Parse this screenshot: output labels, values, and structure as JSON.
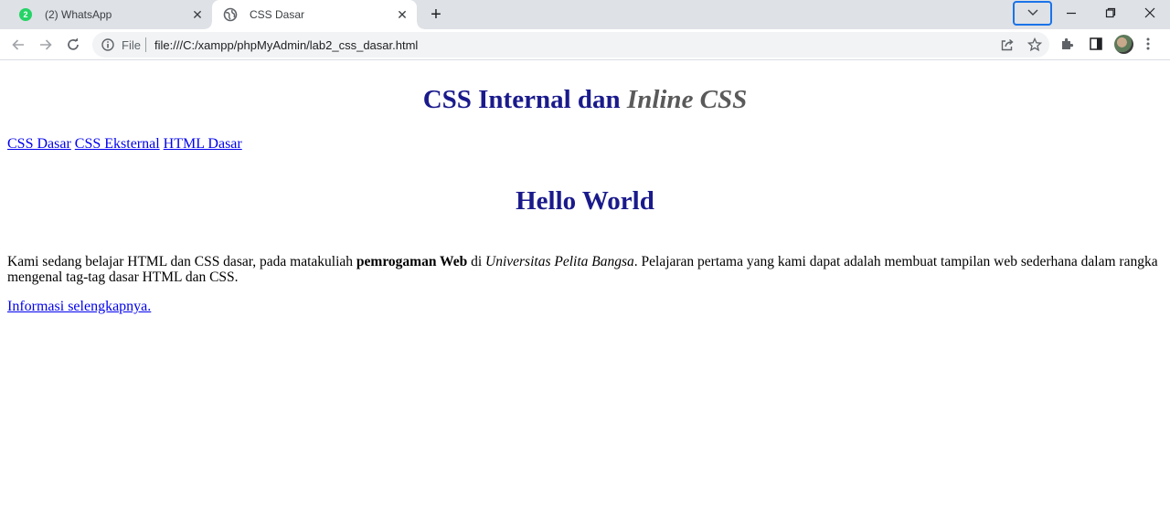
{
  "browser": {
    "tabs": [
      {
        "title": "(2) WhatsApp",
        "badge": "2",
        "icon": "whatsapp-icon",
        "active": false
      },
      {
        "title": "CSS Dasar",
        "icon": "globe-icon",
        "active": true
      }
    ],
    "address": {
      "scheme_label": "File",
      "url": "file:///C:/xampp/phpMyAdmin/lab2_css_dasar.html"
    },
    "colors": {
      "tabstrip": "#dee1e6",
      "focus": "#1a73e8",
      "omnibox": "#f1f3f4"
    }
  },
  "page": {
    "heading": {
      "normal": "CSS Internal dan",
      "italic": "Inline CSS"
    },
    "nav_links": [
      "CSS Dasar",
      "CSS Eksternal",
      "HTML Dasar"
    ],
    "hello": "Hello World",
    "paragraph": {
      "part1": "Kami sedang belajar HTML dan CSS dasar, pada matakuliah ",
      "bold": "pemrogaman Web",
      "part2": " di ",
      "italic": "Universitas Pelita Bangsa",
      "part3": ". Pelajaran pertama yang kami dapat adalah membuat tampilan web sederhana dalam rangka mengenal tag-tag dasar HTML dan CSS."
    },
    "more_link": "Informasi selengkapnya.",
    "colors": {
      "heading": "#1a1a8c",
      "heading_italic": "#5a5a5a",
      "link": "#0000ee"
    }
  }
}
